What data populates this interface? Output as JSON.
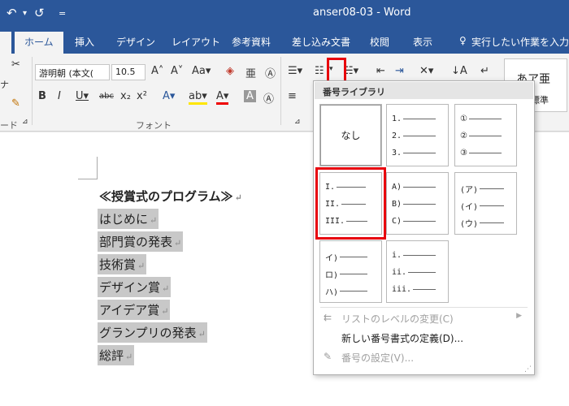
{
  "window": {
    "title": "anser08-03 - Word"
  },
  "quick_access": {
    "undo_icon": "↶",
    "redo_icon": "↺",
    "customize_icon": "="
  },
  "tabs": [
    {
      "label": "ホーム"
    },
    {
      "label": "挿入"
    },
    {
      "label": "デザイン"
    },
    {
      "label": "レイアウト"
    },
    {
      "label": "参考資料"
    },
    {
      "label": "差し込み文書"
    },
    {
      "label": "校閲"
    },
    {
      "label": "表示"
    },
    {
      "label": "実行したい作業を入力し"
    }
  ],
  "ribbon": {
    "font_name": "游明朝 (本文(",
    "font_size": "10.5",
    "font_group_label": "フォント",
    "clipboard_group_label": "ード",
    "styles_preview": "あア亜",
    "styles_caption": "標準"
  },
  "numbering_library": {
    "header": "番号ライブラリ",
    "none_label": "なし",
    "formats": [
      [
        "1.",
        "2.",
        "3."
      ],
      [
        "①",
        "②",
        "③"
      ],
      [
        "I.",
        "II.",
        "III."
      ],
      [
        "A)",
        "B)",
        "C)"
      ],
      [
        "(ア)",
        "(イ)",
        "(ウ)"
      ],
      [
        "イ)",
        "ロ)",
        "ハ)"
      ],
      [
        "i.",
        "ii.",
        "iii."
      ]
    ],
    "menu": [
      {
        "label": "リストのレベルの変更(C)",
        "enabled": false
      },
      {
        "label": "新しい番号書式の定義(D)...",
        "enabled": true
      },
      {
        "label": "番号の設定(V)...",
        "enabled": false
      }
    ]
  },
  "document": {
    "title": "≪授賞式のプログラム≫",
    "lines": [
      "はじめに",
      "部門賞の発表",
      "技術賞",
      "デザイン賞",
      "アイデア賞",
      "グランプリの発表",
      "総評"
    ]
  },
  "colors": {
    "accent": "#2b579a",
    "highlight_red": "#e8000c"
  }
}
